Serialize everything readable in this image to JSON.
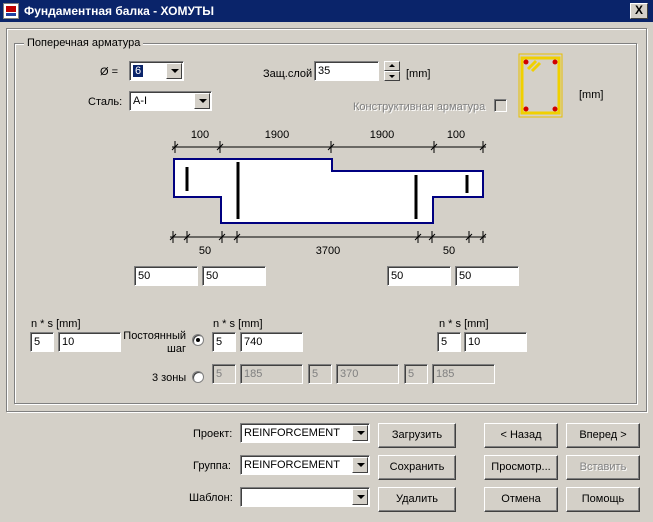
{
  "window": {
    "title": "Фундаментная балка - ХОМУТЫ",
    "close_glyph": "X"
  },
  "group": {
    "title": "Поперечная арматура"
  },
  "diameter": {
    "label": "Ø =",
    "value": "6"
  },
  "steel": {
    "label": "Сталь:",
    "value": "A-I"
  },
  "cover": {
    "label": "Защ.слой",
    "value": "35",
    "unit": "[mm]"
  },
  "constructive": {
    "label": "Конструктивная арматура",
    "checked": false
  },
  "section_unit": "[mm]",
  "diagram": {
    "top_dims": [
      "100",
      "1900",
      "1900",
      "100"
    ],
    "bottom_dims": [
      "50",
      "3700",
      "50"
    ]
  },
  "offsets": [
    "50",
    "50",
    "50",
    "50"
  ],
  "spacing": {
    "left": {
      "header": "n * s [mm]",
      "n": "5",
      "s": "10"
    },
    "middle": {
      "header": "n * s [mm]",
      "n": "5",
      "s": "740"
    },
    "right": {
      "header": "n * s [mm]",
      "n": "5",
      "s": "10"
    },
    "constant_label": "Постоянный шаг",
    "zones_label": "3 зоны",
    "zones": [
      "5",
      "185",
      "5",
      "370",
      "5",
      "185"
    ]
  },
  "bottom": {
    "project": {
      "label": "Проект:",
      "value": "REINFORCEMENT"
    },
    "group": {
      "label": "Группа:",
      "value": "REINFORCEMENT"
    },
    "template": {
      "label": "Шаблон:",
      "value": ""
    },
    "load": "Загрузить",
    "save": "Сохранить",
    "delete": "Удалить",
    "back": "< Назад",
    "next": "Вперед >",
    "preview": "Просмотр...",
    "insert": "Вставить",
    "cancel": "Отмена",
    "help": "Помощь"
  },
  "colors": {
    "titlebar": "#0a246a",
    "beam_outline": "#000080",
    "stirrup_frame": "#f0d000",
    "rebar_dot": "#d00000"
  }
}
